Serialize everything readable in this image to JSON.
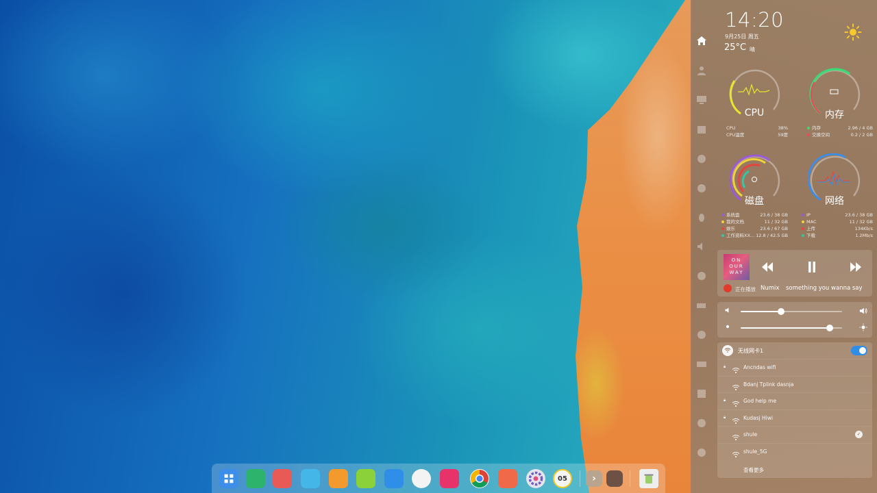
{
  "desktop": {
    "wallpaper": "aerial-coast"
  },
  "panel": {
    "clock": "14:20",
    "date": "9月25日  周五",
    "temperature": "25°C",
    "weather": "晴",
    "weather_icon": "sun-icon",
    "rail_icons": [
      "home-icon",
      "user-icon",
      "monitor-icon",
      "calendar-icon",
      "palette-icon",
      "globe-icon",
      "bluetooth-icon",
      "volume-icon",
      "clock-icon",
      "battery-icon",
      "mouse-icon",
      "keyboard-icon",
      "pen-icon",
      "help-icon",
      "info-icon"
    ],
    "cpu": {
      "label": "CPU",
      "usage": 0.38,
      "rows": [
        {
          "name": "CPU",
          "value": "38%"
        },
        {
          "name": "CPU温度",
          "value": "59度"
        }
      ]
    },
    "memory": {
      "label": "内存",
      "usage": 0.74,
      "rows": [
        {
          "name": "内存",
          "value": "2.96 / 4 GB",
          "color": "#4ed36b"
        },
        {
          "name": "交换空间",
          "value": "0.2 / 2 GB",
          "color": "#e84c5a"
        }
      ]
    },
    "disk": {
      "label": "磁盘",
      "rows": [
        {
          "name": "系统盘",
          "value": "23.6 / 38 GB",
          "color": "#9b5bd6"
        },
        {
          "name": "我的文档",
          "value": "11 / 32 GB",
          "color": "#f2d23a"
        },
        {
          "name": "娱乐",
          "value": "23.6 / 67 GB",
          "color": "#e8443f"
        },
        {
          "name": "工作资料XX…",
          "value": "12.8 / 42.5 GB",
          "color": "#31c8a4"
        }
      ]
    },
    "network": {
      "label": "网络",
      "rows": [
        {
          "name": "IP",
          "value": "23.6 / 38 GB",
          "color": "#9b5bd6"
        },
        {
          "name": "MAC",
          "value": "11 / 32 GB",
          "color": "#f2d23a"
        },
        {
          "name": "上传",
          "value": "134Kb/s",
          "color": "#e8443f"
        },
        {
          "name": "下载",
          "value": "1.2Mb/s",
          "color": "#31c8a4"
        }
      ]
    },
    "music": {
      "album_text": "ON OUR WAY",
      "playing_label": "正在播放",
      "artist": "Numix",
      "song": "something you wanna say"
    },
    "sliders": {
      "volume": 0.4,
      "brightness": 0.88
    },
    "wifi": {
      "title": "无线网卡1",
      "enabled": true,
      "networks": [
        {
          "name": "Ancndas wifi",
          "locked": true,
          "connected": false
        },
        {
          "name": "Bdanj Tplink dasnja",
          "locked": false,
          "connected": false
        },
        {
          "name": "God help me",
          "locked": true,
          "connected": false
        },
        {
          "name": "Kudasj  Hiwi",
          "locked": true,
          "connected": false
        },
        {
          "name": "shule",
          "locked": false,
          "connected": true
        },
        {
          "name": "shule_5G",
          "locked": false,
          "connected": false
        }
      ],
      "more": "查看更多"
    }
  },
  "dock": {
    "apps": [
      {
        "name": "launcher",
        "bg": "#3c8ee8"
      },
      {
        "name": "file-manager",
        "bg": "#2db36b"
      },
      {
        "name": "screen-recorder",
        "bg": "#e85a55"
      },
      {
        "name": "app-store",
        "bg": "#45b6e8"
      },
      {
        "name": "archive-manager",
        "bg": "#f29a2e"
      },
      {
        "name": "music",
        "bg": "#8bd13a"
      },
      {
        "name": "video",
        "bg": "#2f8ee8"
      },
      {
        "name": "image-viewer",
        "bg": "#f3f3f3"
      },
      {
        "name": "screenshot",
        "bg": "#e8336a"
      },
      {
        "name": "chrome",
        "bg": "#ffffff"
      },
      {
        "name": "camera",
        "bg": "#f06a4a"
      },
      {
        "name": "settings",
        "bg": "#e4e4ea"
      },
      {
        "name": "clock",
        "bg": "#f6f6f6"
      }
    ],
    "clock_text": "05",
    "trash": "trash-icon"
  }
}
